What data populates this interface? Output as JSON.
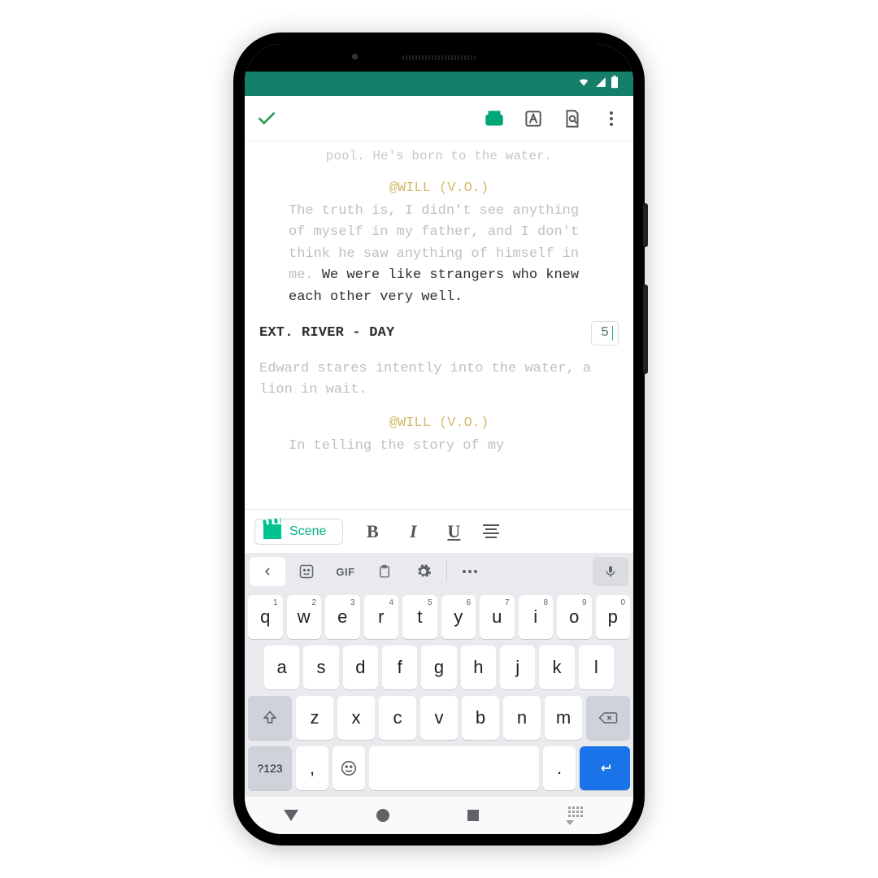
{
  "status": {
    "wifi": true,
    "signal": true,
    "battery": true
  },
  "script": {
    "faded_top": "pool.  He's born to the water.",
    "char1": "@WILL (V.O.)",
    "dlg1_faded": "The truth is, I didn't see anything of myself in my father, and I don't think he saw anything of himself in me. ",
    "dlg1_emph": " We were like strangers who knew each other very well.",
    "scene_heading": "EXT.  RIVER - DAY",
    "scene_number": "5",
    "action1": "Edward stares intently into the water, a lion in wait.",
    "char2": "@WILL (V.O.)",
    "dlg2": "In telling the story of my"
  },
  "format_bar": {
    "chip_label": "Scene",
    "bold": "B",
    "italic": "I",
    "underline": "U"
  },
  "suggest": {
    "gif": "GIF"
  },
  "keyboard": {
    "row1": [
      {
        "k": "q",
        "n": "1"
      },
      {
        "k": "w",
        "n": "2"
      },
      {
        "k": "e",
        "n": "3"
      },
      {
        "k": "r",
        "n": "4"
      },
      {
        "k": "t",
        "n": "5"
      },
      {
        "k": "y",
        "n": "6"
      },
      {
        "k": "u",
        "n": "7"
      },
      {
        "k": "i",
        "n": "8"
      },
      {
        "k": "o",
        "n": "9"
      },
      {
        "k": "p",
        "n": "0"
      }
    ],
    "row2": [
      "a",
      "s",
      "d",
      "f",
      "g",
      "h",
      "j",
      "k",
      "l"
    ],
    "row3": [
      "z",
      "x",
      "c",
      "v",
      "b",
      "n",
      "m"
    ],
    "sym": "?123",
    "comma": ",",
    "period": "."
  }
}
